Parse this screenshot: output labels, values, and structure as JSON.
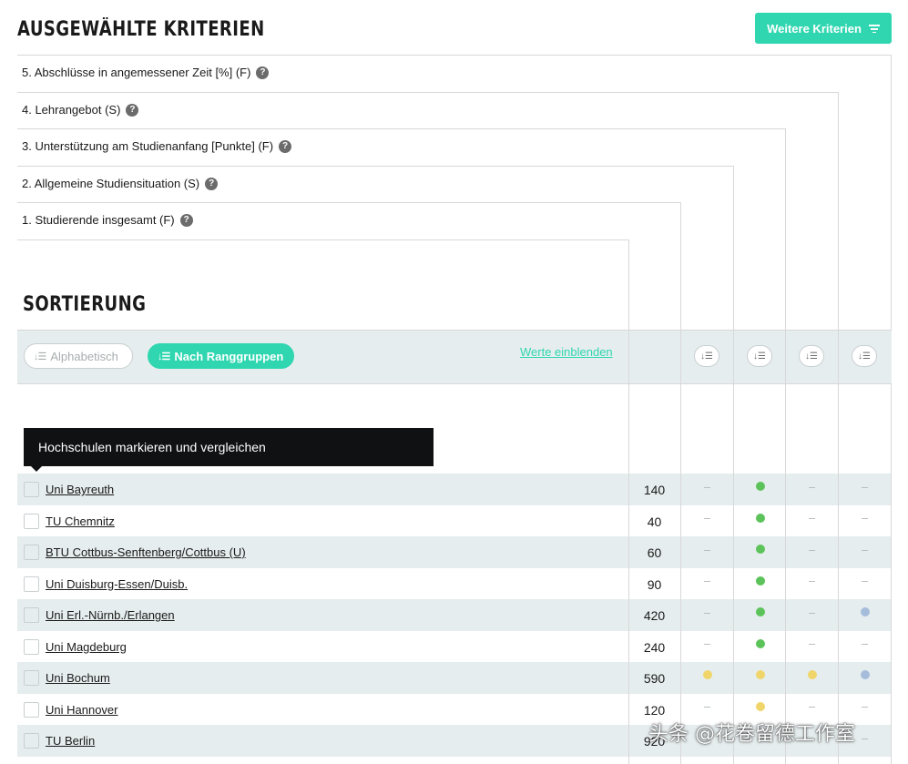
{
  "header": {
    "title": "AUSGEWÄHLTE KRITERIEN",
    "more_button_label": "Weitere Kriterien"
  },
  "criteria": [
    {
      "label": "5. Abschlüsse in angemessener Zeit [%] (F)"
    },
    {
      "label": "4. Lehrangebot (S)"
    },
    {
      "label": "3. Unterstützung am Studienanfang [Punkte] (F)"
    },
    {
      "label": "2. Allgemeine Studiensituation (S)"
    },
    {
      "label": "1. Studierende insgesamt (F)"
    }
  ],
  "sorting": {
    "title": "SORTIERUNG",
    "alphabetical_label": "Alphabetisch",
    "by_rank_groups_label": "Nach Ranggruppen",
    "show_values_label": "Werte einblenden"
  },
  "tooltip": {
    "text": "Hochschulen markieren und vergleichen"
  },
  "colors": {
    "accent": "#2fd6b0",
    "green": "#5cc35a",
    "yellow": "#f0d56a",
    "blue": "#a5bddb"
  },
  "universities": [
    {
      "name": "Uni Bayreuth",
      "students": "140",
      "marks": [
        "none",
        "green",
        "none",
        "none"
      ]
    },
    {
      "name": "TU Chemnitz",
      "students": "40",
      "marks": [
        "none",
        "green",
        "none",
        "none"
      ]
    },
    {
      "name": "BTU Cottbus-Senftenberg/Cottbus (U)",
      "students": "60",
      "marks": [
        "none",
        "green",
        "none",
        "none"
      ]
    },
    {
      "name": "Uni Duisburg-Essen/Duisb.",
      "students": "90",
      "marks": [
        "none",
        "green",
        "none",
        "none"
      ]
    },
    {
      "name": "Uni Erl.-Nürnb./Erlangen",
      "students": "420",
      "marks": [
        "none",
        "green",
        "none",
        "blue"
      ]
    },
    {
      "name": "Uni Magdeburg",
      "students": "240",
      "marks": [
        "none",
        "green",
        "none",
        "none"
      ]
    },
    {
      "name": "Uni Bochum",
      "students": "590",
      "marks": [
        "yellow",
        "yellow",
        "yellow",
        "blue"
      ]
    },
    {
      "name": "Uni Hannover",
      "students": "120",
      "marks": [
        "none",
        "yellow",
        "none",
        "none"
      ]
    },
    {
      "name": "TU Berlin",
      "students": "920",
      "marks": [
        "none",
        "none",
        "none",
        "none"
      ]
    }
  ],
  "watermark": "头条 @花卷留德工作室"
}
